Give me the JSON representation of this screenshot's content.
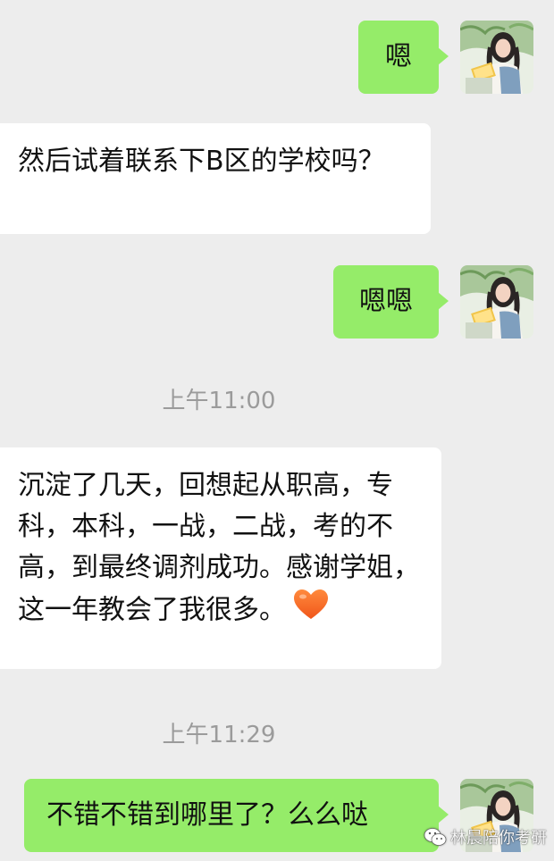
{
  "messages": [
    {
      "side": "out",
      "text": "嗯"
    },
    {
      "side": "in",
      "text": "然后试着联系下B区的学校吗？"
    },
    {
      "side": "out",
      "text": "嗯嗯"
    },
    {
      "type": "time",
      "text": "上午11:00"
    },
    {
      "side": "in",
      "text": "沉淀了几天，回想起从职高，专科，本科，一战，二战，考的不高，到最终调剂成功。感谢学姐，这一年教会了我很多。",
      "emoji": "heart"
    },
    {
      "type": "time",
      "text": "上午11:29"
    },
    {
      "side": "out",
      "text": "不错不错到哪里了？么么哒"
    }
  ],
  "avatar_icon": "girl-photo-avatar",
  "watermark": {
    "text": "林晨陪你考研",
    "icon": "wechat-icon"
  },
  "colors": {
    "background": "#ededed",
    "outgoing_bubble": "#95ec69",
    "incoming_bubble": "#ffffff",
    "timestamp": "#9b9b9b"
  }
}
